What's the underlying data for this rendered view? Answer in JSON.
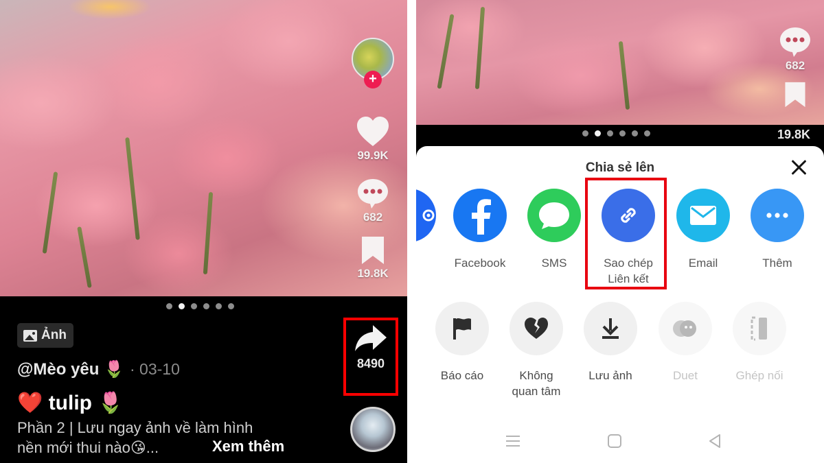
{
  "left_screen": {
    "sidebar": {
      "follow_label": "+",
      "likes": "99.9K",
      "comments": "682",
      "bookmarks": "19.8K",
      "shares": "8490"
    },
    "carousel": {
      "count": 6,
      "active_index": 1
    },
    "post": {
      "type_tag": "Ảnh",
      "author": "@Mèo yêu 🌷",
      "date": "· 03-10",
      "title": "❤️ tulip 🌷",
      "description_line1": "Phần 2 | Lưu ngay ảnh về làm hình",
      "description_line2": "nền mới thui nào😘...",
      "see_more": "Xem thêm"
    },
    "icons": {
      "like": "heart-icon",
      "comment": "comment-bubble-icon",
      "bookmark": "bookmark-icon",
      "share": "share-arrow-icon",
      "music": "music-disc-icon"
    },
    "highlight_color": "#ff0000"
  },
  "right_screen": {
    "sidebar": {
      "comments": "682",
      "bookmarks": "19.8K"
    },
    "carousel": {
      "count": 6,
      "active_index": 1
    },
    "share_sheet": {
      "title": "Chia sẻ lên",
      "close_icon": "close-icon",
      "share_targets": [
        {
          "label": "",
          "icon": "partial-app-icon",
          "color": "#1f66f2"
        },
        {
          "label": "Facebook",
          "icon": "facebook-icon",
          "color": "#1877f2"
        },
        {
          "label": "SMS",
          "icon": "sms-bubble-icon",
          "color": "#2ecc5b"
        },
        {
          "label_line1": "Sao chép",
          "label_line2": "Liên kết",
          "icon": "link-icon",
          "color": "#3a6ee8",
          "highlighted": true
        },
        {
          "label": "Email",
          "icon": "email-icon",
          "color": "#1fb7ea"
        },
        {
          "label": "Thêm",
          "icon": "more-dots-icon",
          "color": "#3897f5"
        }
      ],
      "actions": [
        {
          "label": "Báo cáo",
          "icon": "flag-icon",
          "enabled": true
        },
        {
          "label_line1": "Không",
          "label_line2": "quan tâm",
          "icon": "broken-heart-icon",
          "enabled": true
        },
        {
          "label": "Lưu ảnh",
          "icon": "download-icon",
          "enabled": true
        },
        {
          "label": "Duet",
          "icon": "duet-icon",
          "enabled": false
        },
        {
          "label": "Ghép nối",
          "icon": "stitch-icon",
          "enabled": false
        }
      ]
    },
    "system_nav": [
      "menu-icon",
      "home-square-icon",
      "back-triangle-icon"
    ],
    "highlight_color": "#e80010"
  }
}
